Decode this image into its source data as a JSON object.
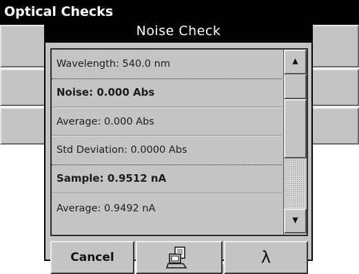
{
  "background_window": {
    "title": "Optical Checks"
  },
  "dialog": {
    "title": "Noise Check",
    "rows": [
      {
        "text": "Wavelength: 540.0 nm",
        "bold": false
      },
      {
        "text": "Noise:  0.000 Abs",
        "bold": true
      },
      {
        "text": "Average:  0.000 Abs",
        "bold": false
      },
      {
        "text": "Std Deviation: 0.0000 Abs",
        "bold": false
      },
      {
        "text": "Sample: 0.9512 nA",
        "bold": true
      },
      {
        "text": "Average: 0.9492 nA",
        "bold": false
      }
    ],
    "scrollbar": {
      "up_icon": "up-arrow-icon",
      "down_icon": "down-arrow-icon",
      "up_glyph": "▲",
      "down_glyph": "▼"
    },
    "buttons": {
      "cancel_label": "Cancel",
      "print_icon": "printer-computer-icon",
      "lambda_icon": "lambda-icon",
      "lambda_glyph": "λ"
    }
  }
}
